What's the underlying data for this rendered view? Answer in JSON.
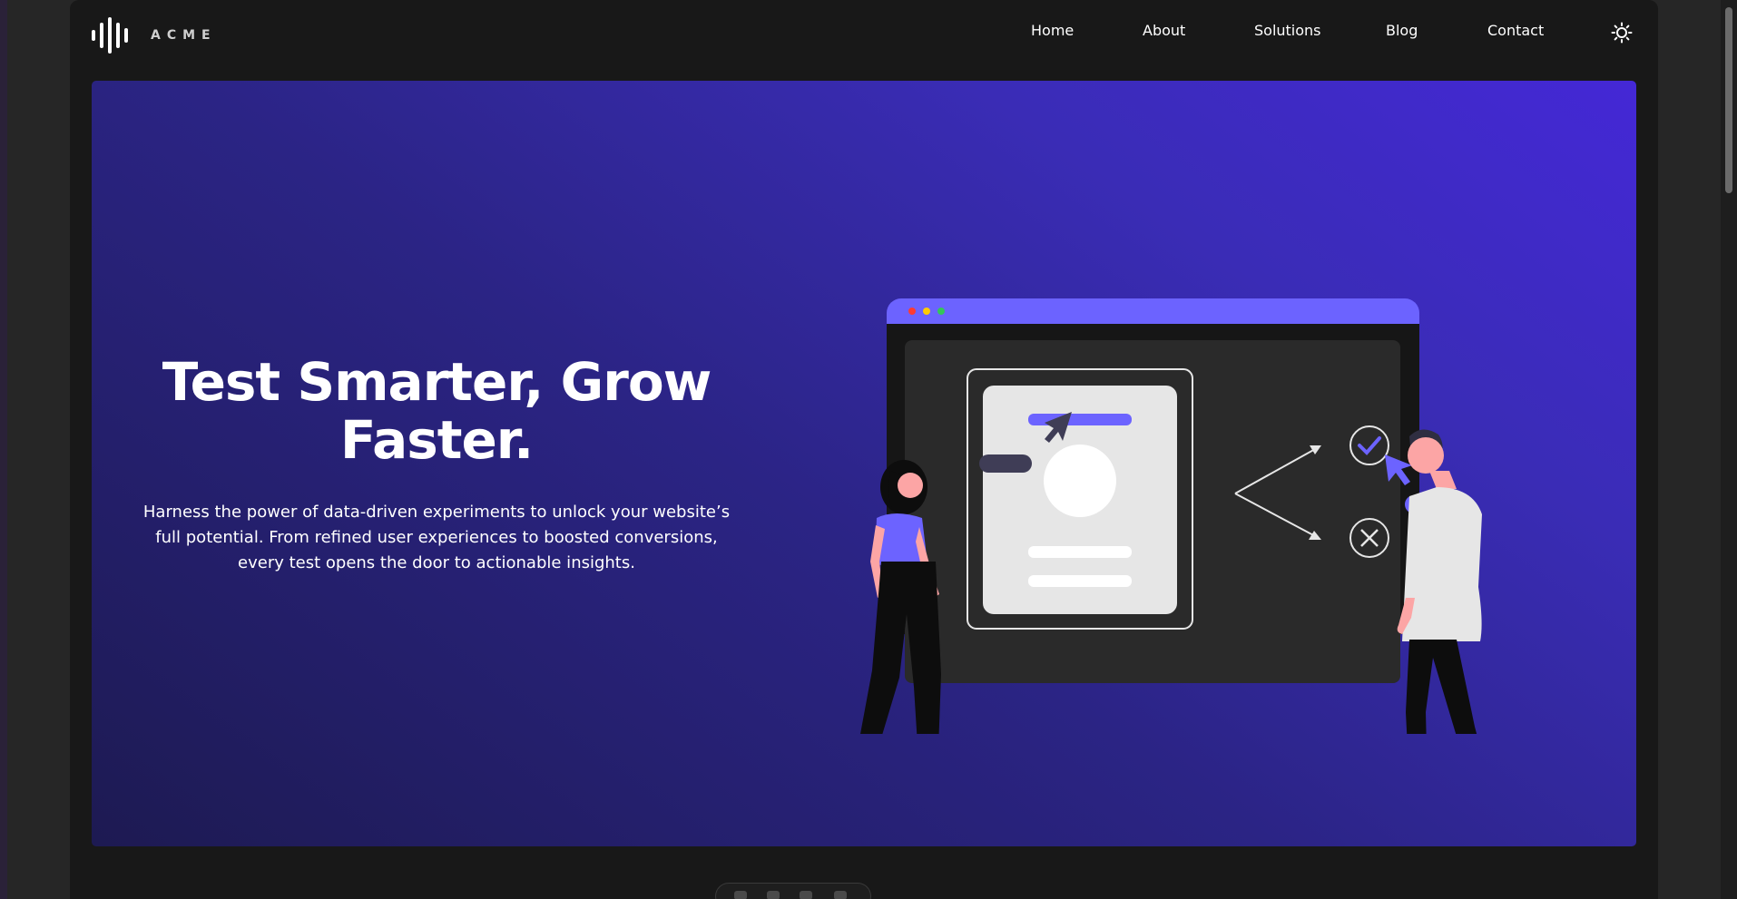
{
  "brand": {
    "name": "ACME"
  },
  "nav": {
    "links": [
      {
        "label": "Home"
      },
      {
        "label": "About"
      },
      {
        "label": "Solutions"
      },
      {
        "label": "Blog"
      },
      {
        "label": "Contact"
      }
    ],
    "theme_toggle_icon": "sun-icon"
  },
  "hero": {
    "title": "Test Smarter, Grow Faster.",
    "description": "Harness the power of data-driven experiments to unlock your website’s full potential. From refined user experiences to boosted conversions, every test opens the door to actionable insights."
  },
  "colors": {
    "accent": "#6c63ff",
    "hero_gradient_start": "#1d1a52",
    "hero_gradient_end": "#4428d6",
    "page_background": "#181818"
  }
}
